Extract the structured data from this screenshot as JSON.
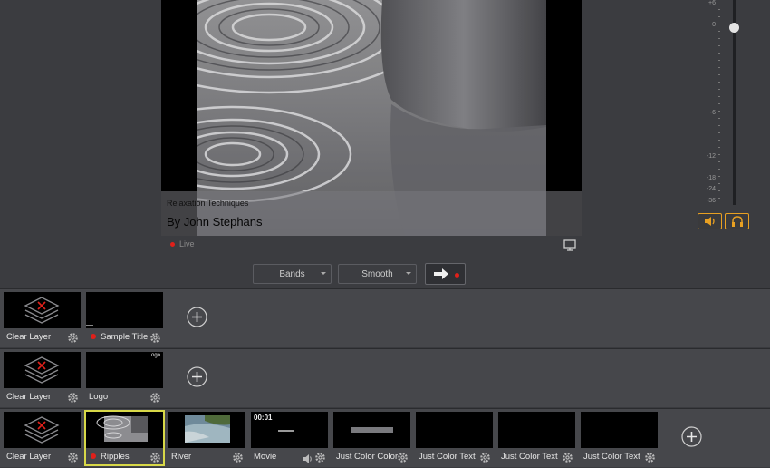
{
  "program": {
    "lower_third": {
      "subtitle": "Relaxation Techniques",
      "title": "By John Stephans"
    },
    "live_label": "Live"
  },
  "controls": {
    "transition_dropdown": {
      "selected": "Bands"
    },
    "easing_dropdown": {
      "selected": "Smooth"
    }
  },
  "audio_meter": {
    "labels": [
      "+6",
      "0",
      "-6",
      "-12",
      "-18",
      "-24",
      "-36"
    ],
    "volume_level": 0.89
  },
  "layers": [
    {
      "clips": [
        {
          "label": "Clear Layer",
          "icon": "clear-layer-icon",
          "live": false
        },
        {
          "label": "Sample Title",
          "icon": "title-icon",
          "live": true
        }
      ]
    },
    {
      "clips": [
        {
          "label": "Clear Layer",
          "icon": "clear-layer-icon",
          "live": false
        },
        {
          "label": "Logo",
          "icon": "logo-icon",
          "live": false,
          "thumb_text": "Logo"
        }
      ]
    },
    {
      "clips": [
        {
          "label": "Clear Layer",
          "icon": "clear-layer-icon",
          "live": false
        },
        {
          "label": "Ripples",
          "icon": "video-icon",
          "live": true,
          "selected": true
        },
        {
          "label": "River",
          "icon": "video-icon",
          "live": false
        },
        {
          "label": "Movie",
          "icon": "video-icon",
          "live": false,
          "thumb_text": "00:01"
        },
        {
          "label": "Just Color Color",
          "icon": "color-icon",
          "live": false
        },
        {
          "label": "Just Color Text",
          "icon": "color-icon",
          "live": false
        },
        {
          "label": "Just Color Text",
          "icon": "color-icon",
          "live": false
        },
        {
          "label": "Just Color Text",
          "icon": "color-icon",
          "live": false
        }
      ]
    }
  ],
  "colors": {
    "accent_orange": "#e8a022",
    "live_red": "#e0201a",
    "selection_yellow": "#d8d848"
  }
}
